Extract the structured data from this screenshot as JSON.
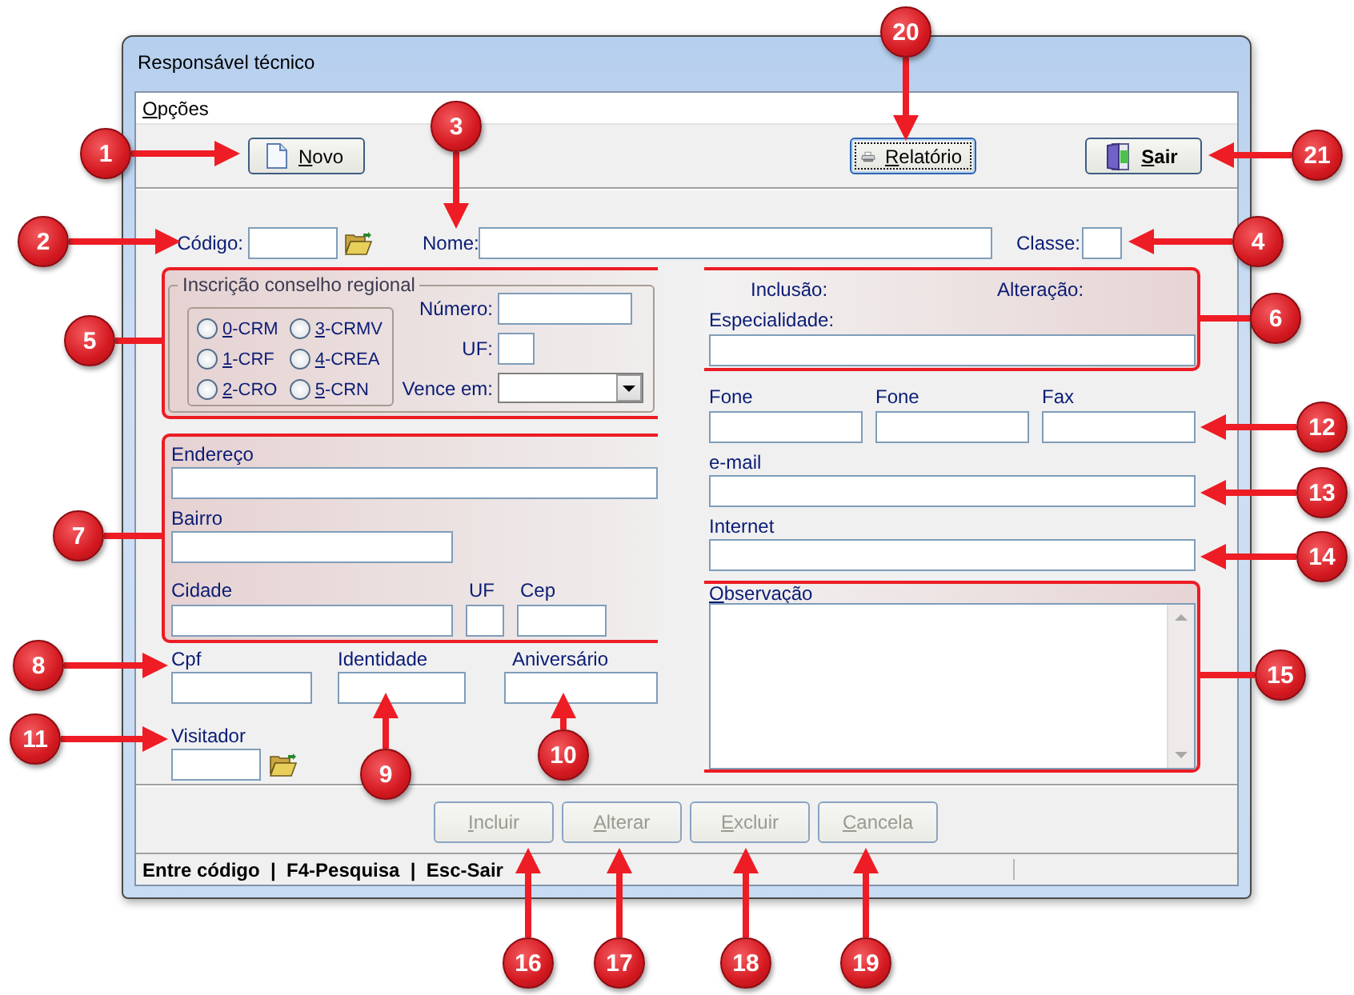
{
  "window": {
    "title": "Responsável técnico"
  },
  "menu": [
    {
      "label": "Opções"
    }
  ],
  "toolbar": [
    {
      "label": "Novo",
      "focused": false
    },
    {
      "label": "Relatório",
      "focused": true
    },
    {
      "label": "Sair",
      "focused": false
    }
  ],
  "header": {
    "code_label": "Código:",
    "name_label": "Nome:",
    "class_label": "Classe:"
  },
  "registration": {
    "title": "Inscrição conselho regional",
    "councils": [
      {
        "label": "0-CRM",
        "selected": false
      },
      {
        "label": "1-CRF",
        "selected": false
      },
      {
        "label": "2-CRO",
        "selected": false
      },
      {
        "label": "3-CRMV",
        "selected": false
      },
      {
        "label": "4-CREA",
        "selected": false
      },
      {
        "label": "5-CRN",
        "selected": false
      }
    ],
    "number_label": "Número:",
    "state_label": "UF:",
    "expires_label": "Vence em:"
  },
  "record": {
    "created_label": "Inclusão:",
    "changed_label": "Alteração:",
    "specialty_label": "Especialidade:"
  },
  "address": {
    "street_label": "Endereço",
    "district_label": "Bairro",
    "city_label": "Cidade",
    "state_label": "UF",
    "zip_label": "Cep"
  },
  "contacts": {
    "phone_1_label": "Fone",
    "phone_2_label": "Fone",
    "fax_label": "Fax",
    "email_label": "e-mail",
    "website_label": "Internet",
    "notes_label": "Observação"
  },
  "personal": {
    "cpf_label": "Cpf",
    "id_label": "Identidade",
    "birthday_label": "Aniversário",
    "visitor_label": "Visitador"
  },
  "actions": [
    {
      "label": "Incluir",
      "disabled": true
    },
    {
      "label": "Alterar",
      "disabled": true
    },
    {
      "label": "Excluir",
      "disabled": true
    },
    {
      "label": "Cancela",
      "disabled": true
    }
  ],
  "status_bar": {
    "text": "Entre código  |  F4-Pesquisa  |  Esc-Sair"
  },
  "callouts": [
    {
      "number": "1"
    },
    {
      "number": "2"
    },
    {
      "number": "3"
    },
    {
      "number": "4"
    },
    {
      "number": "5"
    },
    {
      "number": "6"
    },
    {
      "number": "7"
    },
    {
      "number": "8"
    },
    {
      "number": "9"
    },
    {
      "number": "10"
    },
    {
      "number": "11"
    },
    {
      "number": "12"
    },
    {
      "number": "13"
    },
    {
      "number": "14"
    },
    {
      "number": "15"
    },
    {
      "number": "16"
    },
    {
      "number": "17"
    },
    {
      "number": "18"
    },
    {
      "number": "19"
    },
    {
      "number": "20"
    },
    {
      "number": "21"
    }
  ]
}
